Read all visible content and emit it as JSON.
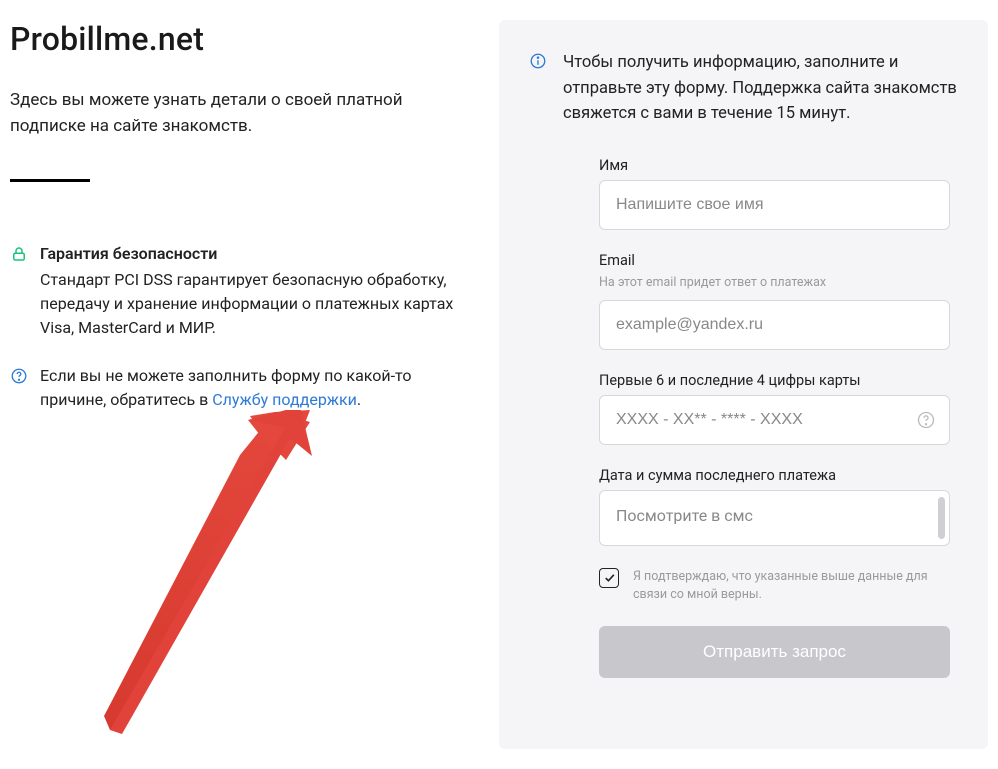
{
  "left": {
    "title": "Probillme.net",
    "intro": "Здесь вы можете узнать детали о своей платной подписке на сайте знакомств.",
    "security": {
      "title": "Гарантия безопасности",
      "body": "Стандарт PCI DSS гарантирует безопасную обработку, передачу и хранение информации о платежных картах Visa, MasterCard и МИР."
    },
    "help": {
      "prefix": "Если вы не можете заполнить форму по какой-то причине, обратитесь в ",
      "link": "Службу поддержки",
      "suffix": "."
    }
  },
  "form": {
    "header": "Чтобы получить информацию, заполните и отправьте эту форму. Поддержка сайта знакомств свяжется с вами в течение 15 минут.",
    "name": {
      "label": "Имя",
      "placeholder": "Напишите свое имя"
    },
    "email": {
      "label": "Email",
      "hint": "На этот email придет ответ о платежах",
      "placeholder": "example@yandex.ru"
    },
    "card": {
      "label": "Первые 6 и последние 4 цифры карты",
      "placeholder": "XXXX - XX** - **** - XXXX"
    },
    "payment": {
      "label": "Дата и сумма последнего платежа",
      "placeholder": "Посмотрите в смс"
    },
    "confirm": "Я подтверждаю, что указанные выше данные для связи со мной верны.",
    "submit": "Отправить запрос"
  }
}
